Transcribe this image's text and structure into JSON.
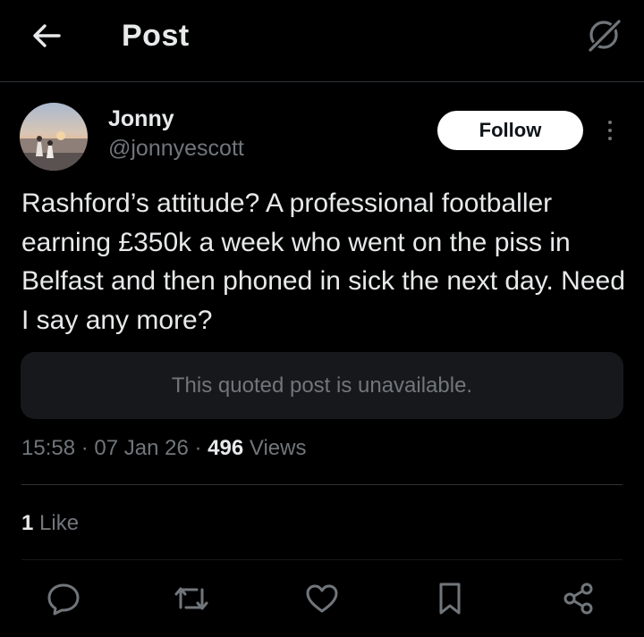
{
  "header": {
    "title": "Post",
    "back_icon": "arrow-left-icon",
    "grok_icon": "grok-icon"
  },
  "author": {
    "name": "Jonny",
    "handle": "@jonnyescott",
    "follow_label": "Follow",
    "more_icon": "more-vertical-icon"
  },
  "post": {
    "text": "Rashford’s attitude? A professional footballer earning £350k a week who went on the piss in Belfast and then phoned in sick the next day. Need I say any more?",
    "quote_unavailable": "This quoted post is unavailable.",
    "time": "15:58",
    "date": "07 Jan 26",
    "separator": "·",
    "views_count": "496",
    "views_label": "Views",
    "likes_count": "1",
    "likes_label": "Like"
  },
  "actions": [
    {
      "name": "reply",
      "icon": "reply-icon"
    },
    {
      "name": "repost",
      "icon": "repost-icon"
    },
    {
      "name": "like",
      "icon": "heart-icon"
    },
    {
      "name": "bookmark",
      "icon": "bookmark-icon"
    },
    {
      "name": "share",
      "icon": "share-icon"
    }
  ],
  "colors": {
    "background": "#000000",
    "text_primary": "#e7e9ea",
    "text_secondary": "#71767b",
    "divider": "#2f3336",
    "quote_bg": "#16181c",
    "follow_bg": "#ffffff"
  }
}
